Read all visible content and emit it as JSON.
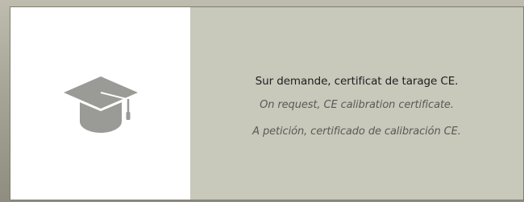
{
  "colors": {
    "icon_panel_background": "#ffffff",
    "text_panel_background": "#c8c8bb",
    "icon_color": "#9a9a96",
    "primary_text": "#1e1e1e",
    "secondary_text": "#5a5a56"
  },
  "icon": {
    "name": "graduation-cap-icon"
  },
  "text": {
    "french": "Sur demande, certificat de tarage CE.",
    "english": "On request, CE calibration certificate.",
    "spanish": "A petición, certificado de calibración CE."
  }
}
